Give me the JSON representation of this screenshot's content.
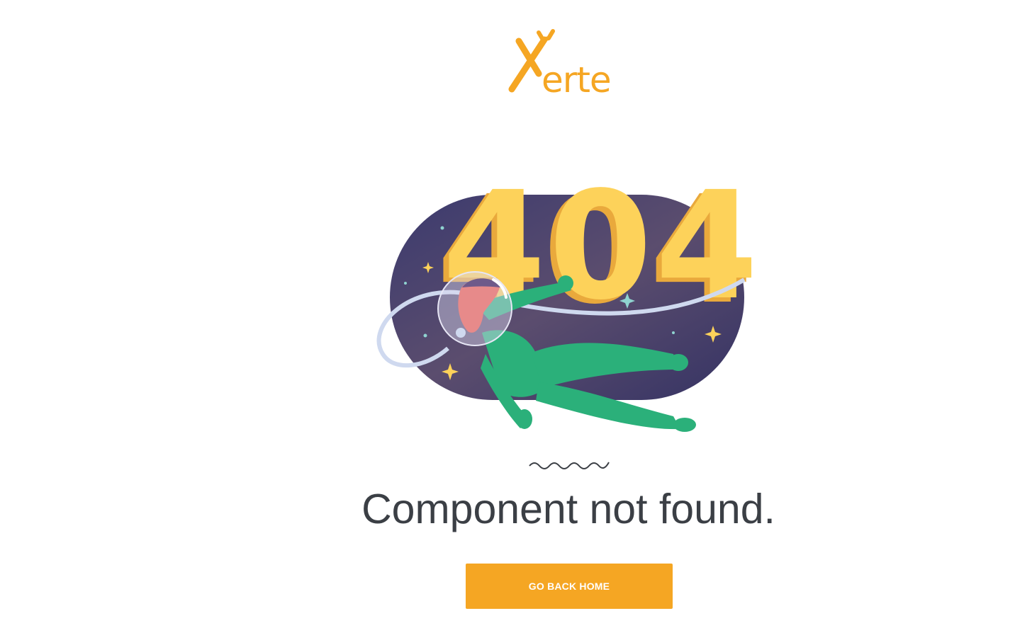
{
  "logo": {
    "text": "erte",
    "icon": "wrench-x-icon",
    "color": "#f5a623"
  },
  "illustration": {
    "code": "404",
    "colors": {
      "space": "#3d3a6b",
      "digits": "#fdd25a",
      "suit": "#2bb07a"
    }
  },
  "main": {
    "message": "Component not found.",
    "button_label": "GO BACK HOME",
    "text_color": "#3b3f45",
    "button_color": "#f5a623"
  }
}
